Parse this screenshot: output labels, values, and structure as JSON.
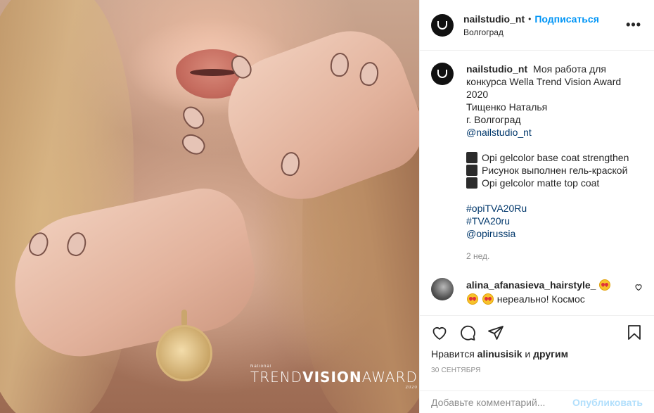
{
  "post": {
    "author": {
      "username": "nailstudio_nt",
      "dot": "•",
      "follow_label": "Подписаться",
      "location": "Волгоград",
      "more_label": "•••"
    },
    "photo": {
      "brand_small": "National",
      "brand_word_1": "TREND",
      "brand_word_2": "VISION",
      "brand_word_3": "AWARD",
      "brand_year": "2020"
    },
    "caption": {
      "username": "nailstudio_nt",
      "lines": [
        "Моя работа для конкурса Wella Trend Vision Award 2020",
        "Тищенко Наталья",
        "г. Волгоград",
        "@nailstudio_nt",
        "Opi gelcolor base coat strengthen",
        "Рисунок выполнен гель-краской",
        "Opi gelcolor matte top coat",
        "#opiTVA20Ru",
        "#TVA20ru",
        "@opirussia"
      ],
      "time_ago": "2 нед."
    },
    "comments": [
      {
        "username": "alina_afanasieva_hairstyle_",
        "text": "нереально! Космос"
      }
    ],
    "likes": {
      "prefix": "Нравится",
      "user": "alinusisik",
      "conj": "и",
      "others": "другим"
    },
    "date": "30 СЕНТЯБРЯ",
    "add_comment": {
      "placeholder": "Добавьте комментарий...",
      "publish_label": "Опубликовать"
    },
    "icons": {
      "like": "heart-icon",
      "comment": "comment-icon",
      "share": "share-icon",
      "save": "bookmark-icon",
      "more": "more-icon"
    },
    "colors": {
      "accent": "#0095f6",
      "link": "#00376b",
      "muted": "#8e8e8e",
      "publish_disabled": "#b2dffc"
    }
  }
}
